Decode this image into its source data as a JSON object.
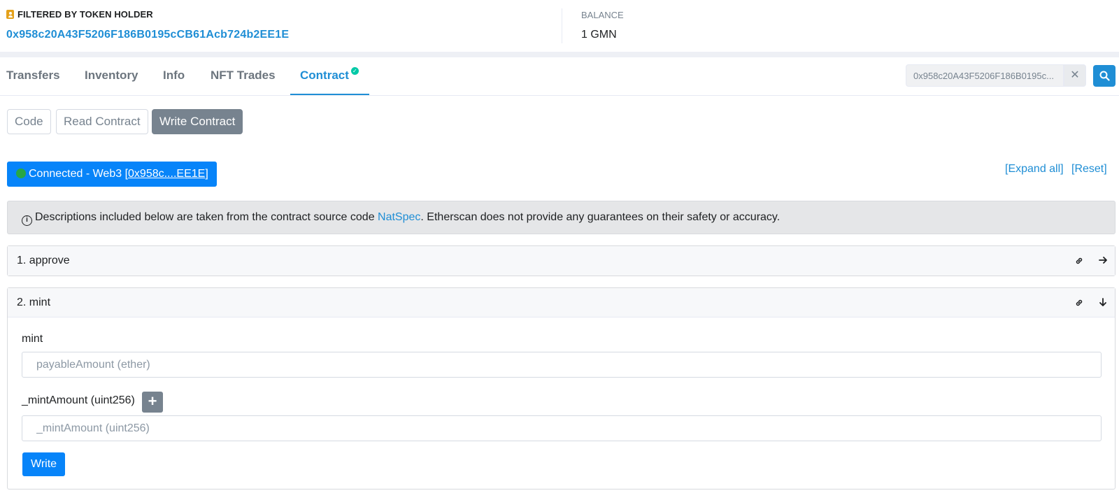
{
  "holder": {
    "label": "FILTERED BY TOKEN HOLDER",
    "address": "0x958c20A43F5206F186B0195cCB61Acb724b2EE1E"
  },
  "balance": {
    "label": "BALANCE",
    "value": "1 GMN"
  },
  "tabs": [
    {
      "label": "Transfers"
    },
    {
      "label": "Inventory"
    },
    {
      "label": "Info"
    },
    {
      "label": "NFT Trades"
    },
    {
      "label": "Contract",
      "active": true,
      "verified": true
    }
  ],
  "search": {
    "value": "0x958c20A43F5206F186B0195c..."
  },
  "subtabs": [
    {
      "label": "Code"
    },
    {
      "label": "Read Contract"
    },
    {
      "label": "Write Contract",
      "active": true
    }
  ],
  "connection": {
    "label": "Connected - Web3 [",
    "address": "0x958c....EE1E",
    "suffix": "]"
  },
  "actions": {
    "expand_all": "[Expand all]",
    "reset": "[Reset]"
  },
  "notice": {
    "text_before": "Descriptions included below are taken from the contract source code ",
    "link": "NatSpec",
    "text_after": ". Etherscan does not provide any guarantees on their safety or accuracy."
  },
  "functions": [
    {
      "title": "1. approve",
      "expanded": false
    },
    {
      "title": "2. mint",
      "expanded": true,
      "payable_label": "mint",
      "payable_placeholder": "payableAmount (ether)",
      "param_label": "_mintAmount (uint256)",
      "param_placeholder": "_mintAmount (uint256)",
      "plus_label": "+",
      "write_label": "Write"
    }
  ],
  "colors": {
    "accent": "#1f8ed5",
    "primary_button": "#0784f9",
    "connected_dot": "#28a745",
    "verified_check": "#00c9a7",
    "holder_icon": "#e4a11b"
  }
}
